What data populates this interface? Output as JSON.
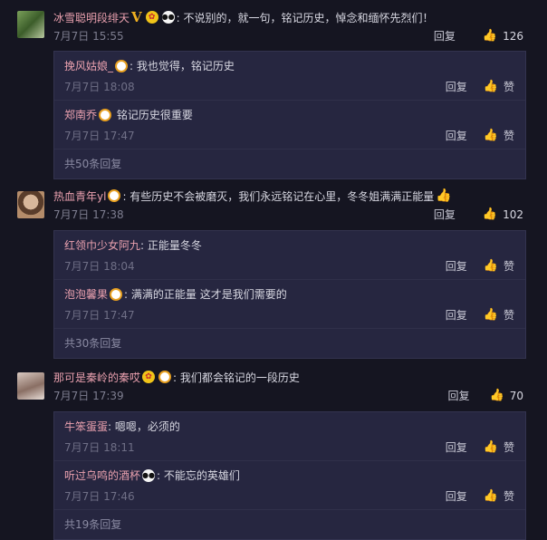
{
  "comments": [
    {
      "user": "冰雪聪明段绯天",
      "text": "不说别的，就一句，铭记历史，悼念和缅怀先烈们！",
      "date": "7月7日 15:55",
      "reply_label": "回复",
      "likes": "126",
      "replies": [
        {
          "user": "挽风姑娘_",
          "text": "我也觉得，铭记历史",
          "date": "7月7日 18:08",
          "reply_label": "回复",
          "like_label": "赞"
        },
        {
          "user": "郑南乔",
          "text": "铭记历史很重要",
          "date": "7月7日 17:47",
          "reply_label": "回复",
          "like_label": "赞"
        }
      ],
      "more": "共50条回复"
    },
    {
      "user": "热血青年yl",
      "text": "有些历史不会被磨灭，我们永远铭记在心里，冬冬姐满满正能量",
      "date": "7月7日 17:38",
      "reply_label": "回复",
      "likes": "102",
      "replies": [
        {
          "user": "红领巾少女阿九",
          "text": "正能量冬冬",
          "date": "7月7日 18:04",
          "reply_label": "回复",
          "like_label": "赞"
        },
        {
          "user": "泡泡馨果",
          "text": "满满的正能量 这才是我们需要的",
          "date": "7月7日 17:47",
          "reply_label": "回复",
          "like_label": "赞"
        }
      ],
      "more": "共30条回复"
    },
    {
      "user": "那可是秦岭的秦哎",
      "text": "我们都会铭记的一段历史",
      "date": "7月7日 17:39",
      "reply_label": "回复",
      "likes": "70",
      "replies": [
        {
          "user": "牛笨蛋蛋",
          "text": "嗯嗯，必须的",
          "date": "7月7日 18:11",
          "reply_label": "回复",
          "like_label": "赞"
        },
        {
          "user": "听过乌鸣的酒杯",
          "text": "不能忘的英雄们",
          "date": "7月7日 17:46",
          "reply_label": "回复",
          "like_label": "赞"
        }
      ],
      "more": "共19条回复"
    }
  ],
  "icons": {
    "vip": "V",
    "club": "✿",
    "panda": "🐼",
    "ring": "◎",
    "thumbs_up": "👍",
    "like": "♡"
  },
  "colors": {
    "background": "#151521",
    "username": "#e9a0ae",
    "reply_panel": "#262640",
    "meta": "#7e7e90"
  }
}
